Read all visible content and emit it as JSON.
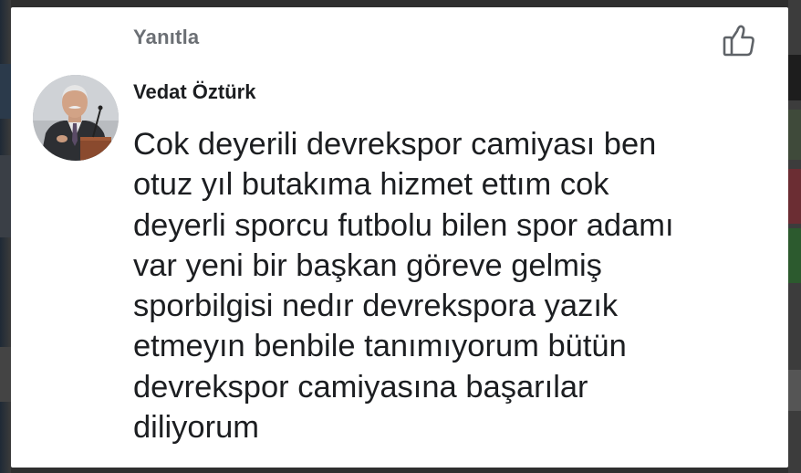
{
  "reply": {
    "label": "Yanıtla"
  },
  "like": {
    "icon": "thumbs-up-icon"
  },
  "comment": {
    "author": "Vedat Öztürk",
    "avatar_icon": "avatar",
    "text": "Cok deyerili devrekspor camiyası ben\notuz yıl butakıma hizmet ettım cok\ndeyerli sporcu futbolu bilen spor adamı\nvar yeni bir başkan göreve gelmiş\nsporbilgisi nedır devrekspora yazık\netmeyın benbile tanımıyorum bütün\ndevrekspor camiyasına başarılar\ndiliyorum"
  },
  "colors": {
    "card_background": "#ffffff",
    "secondary_text": "#6b6f74",
    "primary_text": "#1c1e21",
    "backdrop": "#2f2f2f"
  }
}
